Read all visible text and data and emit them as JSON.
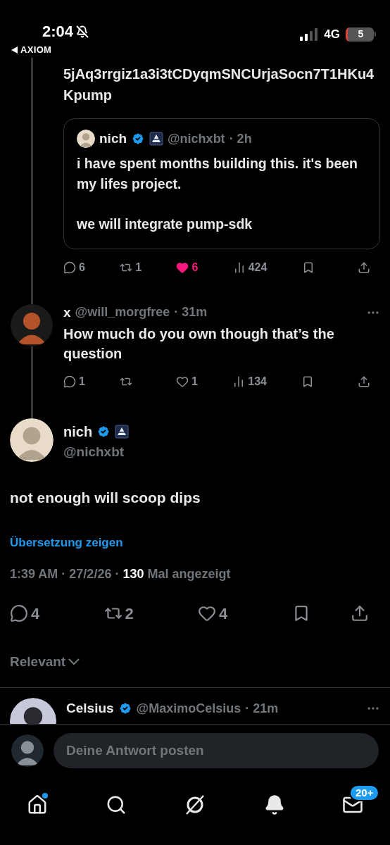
{
  "status_bar": {
    "time": "2:04",
    "back_label": "AXIOM",
    "network": "4G",
    "battery": "5"
  },
  "parent_post": {
    "text": "5jAq3rrgiz1a3i3tCDyqmSNCUrjaSocn7T1HKu4Kpump",
    "quoted_post": {
      "name": "nich",
      "verified": true,
      "handle": "@nichxbt",
      "time": "· 2h",
      "paragraphs": [
        "i have spent months building this. it's been my lifes project.",
        "we will integrate pump-sdk"
      ]
    },
    "actions": [
      {
        "kind": "reply",
        "count": "6"
      },
      {
        "kind": "repost",
        "count": "1"
      },
      {
        "kind": "like",
        "count": "6",
        "liked": true
      },
      {
        "kind": "views",
        "count": "424"
      },
      {
        "kind": "bookmark"
      },
      {
        "kind": "share"
      }
    ]
  },
  "reply_post": {
    "name": "x",
    "handle": "@will_morgfree",
    "time": "· 31m",
    "text": "How much do you own though that’s the question",
    "actions": [
      {
        "kind": "reply",
        "count": "1"
      },
      {
        "kind": "repost"
      },
      {
        "kind": "like",
        "count": "1",
        "liked": false
      },
      {
        "kind": "views",
        "count": "134"
      },
      {
        "kind": "bookmark"
      },
      {
        "kind": "share"
      }
    ]
  },
  "main_post": {
    "name": "nich",
    "verified": true,
    "handle": "@nichxbt",
    "text": "not enough will scoop dips",
    "translate_link": "Übersetzung zeigen",
    "meta": "1:39 AM · 27/2/26 · **130** Mal angezeigt",
    "actions": [
      {
        "kind": "reply",
        "count": "4"
      },
      {
        "kind": "repost",
        "count": "2"
      },
      {
        "kind": "like",
        "count": "4",
        "liked": false
      },
      {
        "kind": "bookmark"
      },
      {
        "kind": "share"
      }
    ]
  },
  "sort_label": "Relevant",
  "next_reply": {
    "name": "Celsius",
    "verified": true,
    "handle": "@MaximoCelsius",
    "time": "· 21m"
  },
  "composer": {
    "placeholder": "Deine Antwort posten"
  },
  "bottom_nav": [
    {
      "kind": "home",
      "unread": true
    },
    {
      "kind": "search",
      "unread": false
    },
    {
      "kind": "grok",
      "unread": false
    },
    {
      "kind": "notifications",
      "unread": false
    },
    {
      "kind": "messages",
      "unread": false,
      "badge": "20+"
    }
  ]
}
